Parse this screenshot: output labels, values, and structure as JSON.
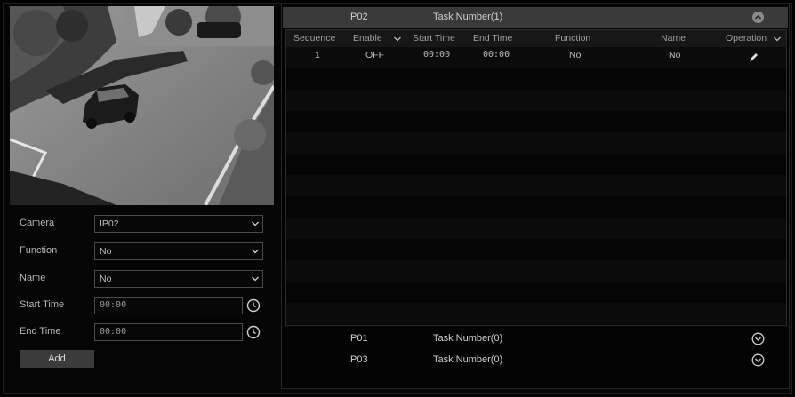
{
  "form": {
    "camera_label": "Camera",
    "camera_value": "IP02",
    "function_label": "Function",
    "function_value": "No",
    "name_label": "Name",
    "name_value": "No",
    "start_label": "Start Time",
    "start_value": "00:00",
    "end_label": "End Time",
    "end_value": "00:00",
    "add_label": "Add"
  },
  "groups": {
    "active": {
      "name": "IP02",
      "task": "Task Number(1)"
    },
    "collapsed": [
      {
        "name": "IP01",
        "task": "Task Number(0)"
      },
      {
        "name": "IP03",
        "task": "Task Number(0)"
      }
    ]
  },
  "table": {
    "headers": {
      "sequence": "Sequence",
      "enable": "Enable",
      "start": "Start Time",
      "end": "End Time",
      "function": "Function",
      "name": "Name",
      "operation": "Operation"
    },
    "rows": [
      {
        "sequence": "1",
        "enable": "OFF",
        "start": "00:00",
        "end": "00:00",
        "function": "No",
        "name": "No"
      }
    ]
  },
  "icons": {
    "camera_dropdown": "chevron-down-icon",
    "clock": "clock-icon",
    "expand": "chevron-circle-down-icon",
    "collapse": "chevron-circle-up-icon",
    "edit": "pencil-icon"
  }
}
